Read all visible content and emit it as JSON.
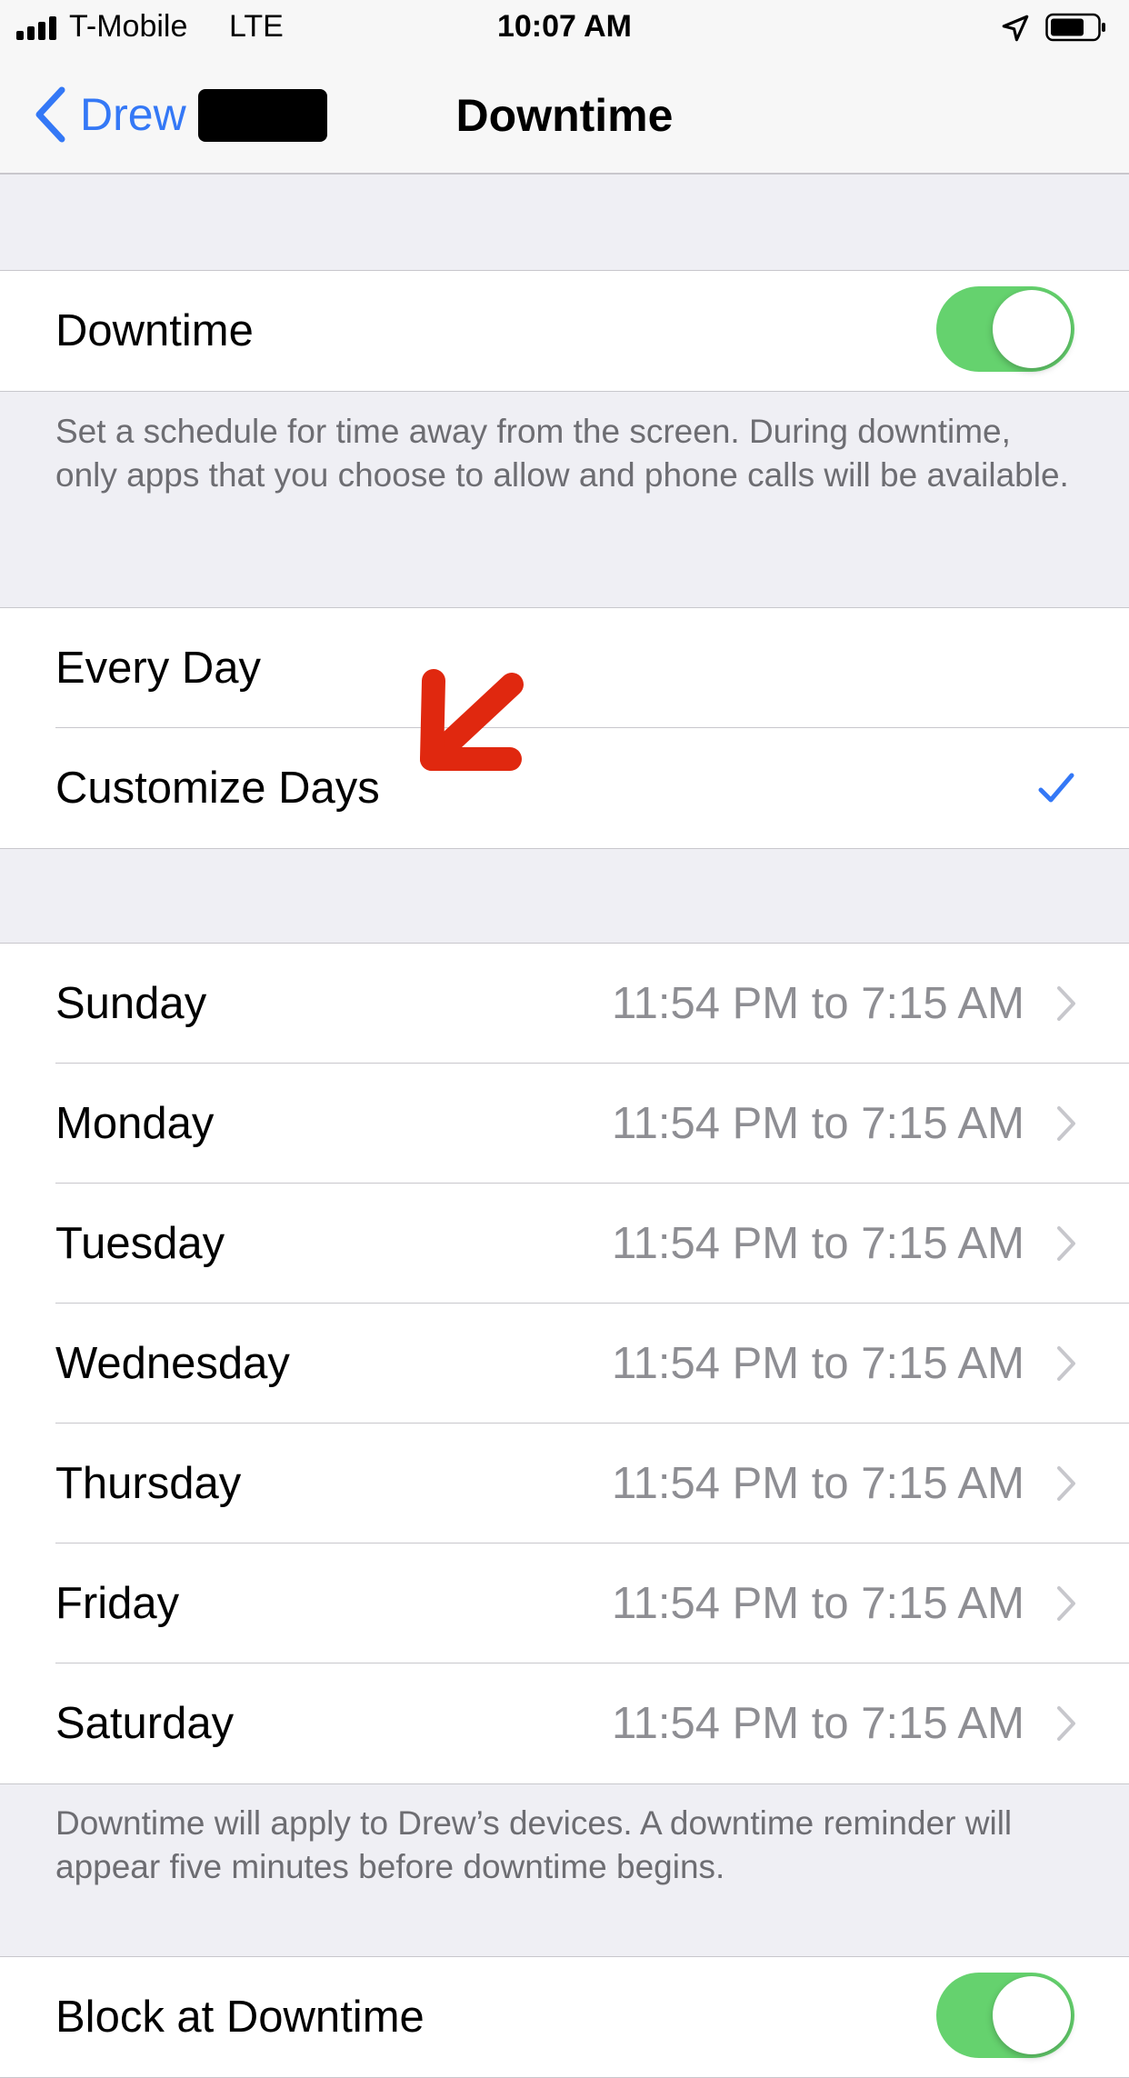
{
  "status_bar": {
    "carrier": "T-Mobile",
    "network": "LTE",
    "time": "10:07 AM"
  },
  "nav": {
    "back_label": "Drew",
    "title": "Downtime"
  },
  "downtime_toggle": {
    "label": "Downtime",
    "on": true,
    "description": "Set a schedule for time away from the screen. During downtime, only apps that you choose to allow and phone calls will be available."
  },
  "schedule_mode": {
    "options": [
      "Every Day",
      "Customize Days"
    ],
    "selected": "Customize Days"
  },
  "days": [
    {
      "day": "Sunday",
      "time": "11:54 PM to 7:15 AM"
    },
    {
      "day": "Monday",
      "time": "11:54 PM to 7:15 AM"
    },
    {
      "day": "Tuesday",
      "time": "11:54 PM to 7:15 AM"
    },
    {
      "day": "Wednesday",
      "time": "11:54 PM to 7:15 AM"
    },
    {
      "day": "Thursday",
      "time": "11:54 PM to 7:15 AM"
    },
    {
      "day": "Friday",
      "time": "11:54 PM to 7:15 AM"
    },
    {
      "day": "Saturday",
      "time": "11:54 PM to 7:15 AM"
    }
  ],
  "days_footer": "Downtime will apply to Drew’s devices. A downtime reminder will appear five minutes before downtime begins.",
  "block_at_downtime": {
    "label": "Block at Downtime",
    "on": true
  },
  "colors": {
    "accent": "#3478f6",
    "toggle_on": "#65d26e",
    "annotation": "#e0280f"
  }
}
